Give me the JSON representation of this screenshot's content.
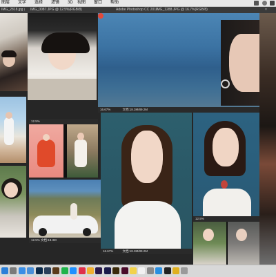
{
  "menu": [
    "图层",
    "文字",
    "选择",
    "滤镜",
    "3D",
    "视图",
    "窗口",
    "帮助"
  ],
  "app_title": "Adobe Photoshop CC 2017",
  "tabs": [
    {
      "label": "IMG_2818.jpg @ ...",
      "close": "×"
    },
    {
      "label": "IMG_0087.JPG @ 12.5%(RGB/8)",
      "close": "×"
    },
    {
      "label": "IMG_1288.JPG @ 16.7%(RGB/8)",
      "close": "×"
    }
  ],
  "docs": {
    "center_top_zoom": "16.67%",
    "center_top_info": "文档:18.3M/89.2M",
    "left_mid_zoom": "12.5%",
    "center_main_zoom": "16.67%",
    "center_main_info": "文档:18.3M/89.2M",
    "left_bottom_info": "12.5%  文档:18.3M",
    "right_bottom_zoom": "12.5%"
  },
  "dock_icons": [
    {
      "name": "finder-icon",
      "color": "#2a7fd8"
    },
    {
      "name": "launchpad-icon",
      "color": "#7a7a7a"
    },
    {
      "name": "safari-icon",
      "color": "#3a8ee6"
    },
    {
      "name": "mail-icon",
      "color": "#4a90d9"
    },
    {
      "name": "photoshop-icon",
      "color": "#0b2a4a"
    },
    {
      "name": "lightroom-icon",
      "color": "#2a3f5a"
    },
    {
      "name": "bridge-icon",
      "color": "#5a3a1a"
    },
    {
      "name": "wechat-icon",
      "color": "#1fb34a"
    },
    {
      "name": "qq-icon",
      "color": "#1e90ff"
    },
    {
      "name": "music-icon",
      "color": "#e0304a"
    },
    {
      "name": "photos-icon",
      "color": "#f0b030"
    },
    {
      "name": "premiere-icon",
      "color": "#2a1a4a"
    },
    {
      "name": "aftereffects-icon",
      "color": "#1a1a4a"
    },
    {
      "name": "illustrator-icon",
      "color": "#3a2a0a"
    },
    {
      "name": "indesign-icon",
      "color": "#4a0a2a"
    },
    {
      "name": "notes-icon",
      "color": "#f2d24a"
    },
    {
      "name": "calendar-icon",
      "color": "#f2f2f2"
    },
    {
      "name": "settings-icon",
      "color": "#8a8a8a"
    },
    {
      "name": "appstore-icon",
      "color": "#2a8fe0"
    },
    {
      "name": "terminal-icon",
      "color": "#222222"
    },
    {
      "name": "chrome-icon",
      "color": "#e0b020"
    },
    {
      "name": "trash-icon",
      "color": "#9a9a9a"
    }
  ]
}
